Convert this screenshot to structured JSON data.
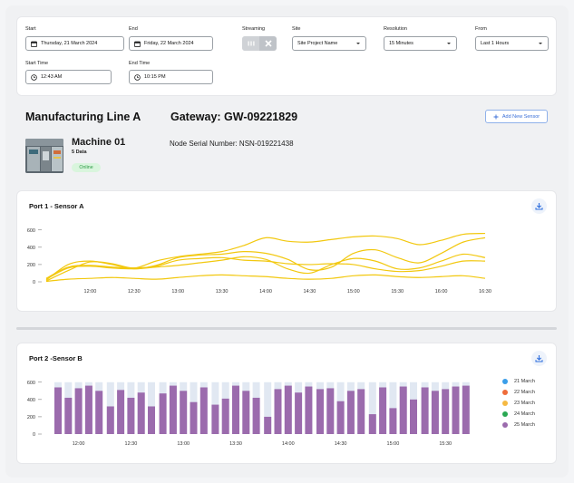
{
  "filters": {
    "start": {
      "label": "Start",
      "value": "Thursday, 21 March 2024"
    },
    "end": {
      "label": "End",
      "value": "Friday, 22 March 2024"
    },
    "streaming": {
      "label": "Streaming"
    },
    "site": {
      "label": "Site",
      "value": "Site Project Name"
    },
    "resolution": {
      "label": "Resolution",
      "value": "15 Minutes"
    },
    "from": {
      "label": "From",
      "value": "Last 1 Hours"
    },
    "start_time": {
      "label": "Start Time",
      "value": "12:43 AM"
    },
    "end_time": {
      "label": "End Time",
      "value": "10:15 PM"
    }
  },
  "header": {
    "line_title": "Manufacturing Line A",
    "gateway": "Gateway: GW-09221829",
    "add_sensor": "Add New Sensor"
  },
  "machine": {
    "name": "Machine 01",
    "data_count": "5 Data",
    "status": "Online",
    "serial": "Node Serial Number: NSN-019221438"
  },
  "chart_data": [
    {
      "type": "line",
      "title": "Port 1 - Sensor A",
      "x": [
        "11:30",
        "11:45",
        "12:00",
        "12:15",
        "12:30",
        "12:45",
        "13:00",
        "13:15",
        "13:30",
        "13:45",
        "14:00",
        "14:15",
        "14:30",
        "14:45",
        "15:00",
        "15:15",
        "15:30",
        "15:45",
        "16:00",
        "16:15",
        "16:30"
      ],
      "xticks": [
        "12:00",
        "12:30",
        "13:00",
        "13:30",
        "14:00",
        "14:30",
        "15:00",
        "15:30",
        "16:00",
        "16:30"
      ],
      "yticks": [
        "0",
        "200",
        "400",
        "600"
      ],
      "ylim": [
        0,
        650
      ],
      "color": "#f2c80f",
      "series": [
        {
          "values": [
            10,
            130,
            230,
            210,
            160,
            240,
            290,
            320,
            350,
            420,
            510,
            470,
            460,
            490,
            520,
            530,
            500,
            430,
            480,
            550,
            560
          ]
        },
        {
          "values": [
            20,
            200,
            240,
            200,
            150,
            190,
            280,
            310,
            320,
            350,
            330,
            260,
            140,
            170,
            330,
            370,
            280,
            220,
            330,
            460,
            510
          ]
        },
        {
          "values": [
            30,
            160,
            180,
            160,
            150,
            170,
            190,
            220,
            250,
            290,
            260,
            150,
            100,
            200,
            270,
            240,
            150,
            160,
            240,
            320,
            280
          ]
        },
        {
          "values": [
            40,
            170,
            190,
            170,
            160,
            180,
            250,
            270,
            280,
            250,
            240,
            210,
            200,
            210,
            200,
            150,
            120,
            130,
            180,
            240,
            240
          ]
        },
        {
          "values": [
            5,
            30,
            40,
            50,
            40,
            30,
            50,
            70,
            80,
            70,
            60,
            40,
            30,
            40,
            70,
            80,
            60,
            50,
            60,
            70,
            40
          ]
        }
      ]
    },
    {
      "type": "bar",
      "title": "Port 2 -Sensor B",
      "xticks": [
        "12:00",
        "12:30",
        "13:00",
        "13:30",
        "14:00",
        "14:30",
        "15:00",
        "15:30"
      ],
      "yticks": [
        "0",
        "200",
        "400",
        "600"
      ],
      "ylim": [
        0,
        650
      ],
      "max_value": 600,
      "background_color": "#e1e8f2",
      "series": [
        {
          "name": "21 March",
          "color": "#3b9ee9"
        },
        {
          "name": "22 March",
          "color": "#ef6c3a"
        },
        {
          "name": "23 March",
          "color": "#f5b942"
        },
        {
          "name": "24 March",
          "color": "#2aa853"
        },
        {
          "name": "25 March",
          "color": "#9b6bad"
        }
      ],
      "groups": [
        [
          540,
          420,
          530,
          560,
          500
        ],
        [
          320,
          510,
          420,
          480,
          320
        ],
        [
          470,
          560,
          500,
          370,
          540
        ],
        [
          340,
          410,
          560,
          500,
          420
        ],
        [
          200,
          520,
          560,
          480,
          550
        ],
        [
          520,
          530,
          380,
          500,
          520
        ],
        [
          230,
          540,
          300,
          550,
          400
        ],
        [
          540,
          500,
          520,
          550,
          560
        ]
      ]
    }
  ]
}
